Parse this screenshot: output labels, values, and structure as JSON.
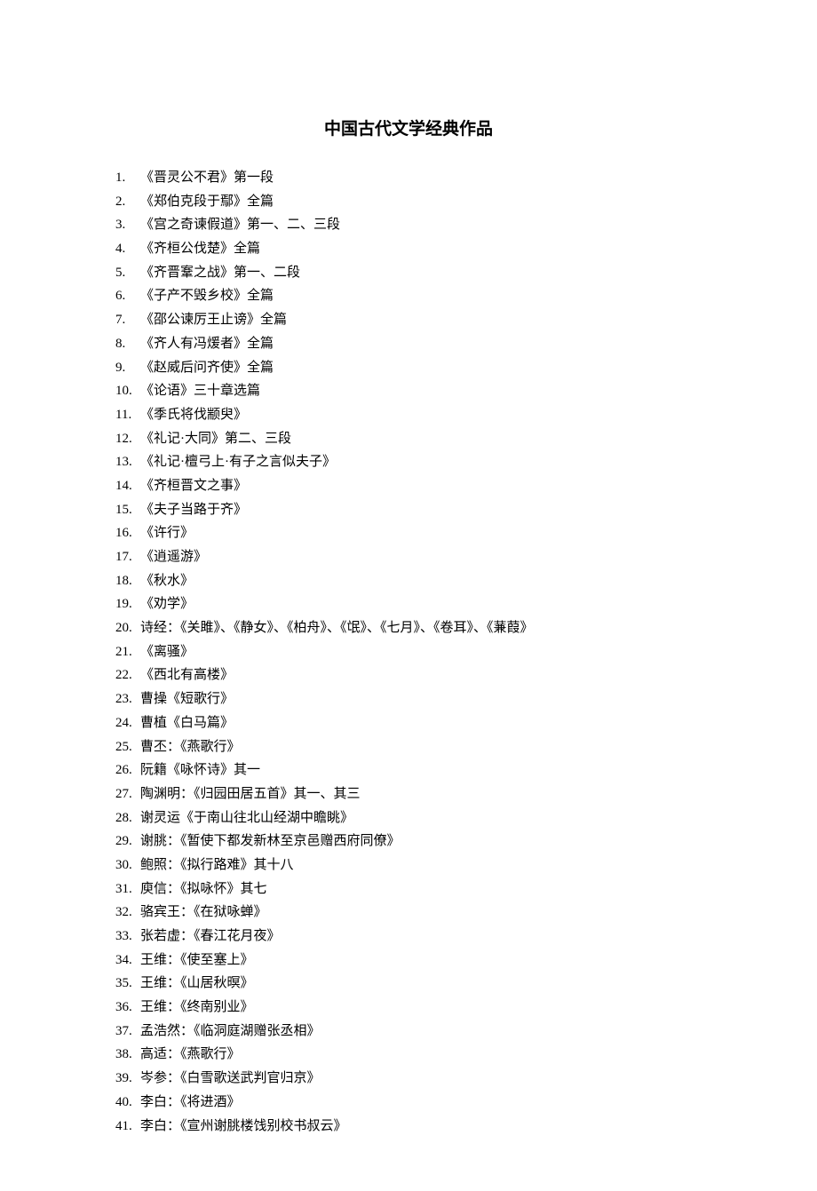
{
  "title": "中国古代文学经典作品",
  "items": [
    {
      "num": "1.",
      "text": "《晋灵公不君》第一段"
    },
    {
      "num": "2.",
      "text": "《郑伯克段于鄢》全篇"
    },
    {
      "num": "3.",
      "text": "《宫之奇谏假道》第一、二、三段"
    },
    {
      "num": "4.",
      "text": "《齐桓公伐楚》全篇"
    },
    {
      "num": "5.",
      "text": "《齐晋鞌之战》第一、二段"
    },
    {
      "num": "6.",
      "text": "《子产不毁乡校》全篇"
    },
    {
      "num": "7.",
      "text": "《邵公谏厉王止谤》全篇"
    },
    {
      "num": "8.",
      "text": "《齐人有冯煖者》全篇"
    },
    {
      "num": "9.",
      "text": "《赵威后问齐使》全篇"
    },
    {
      "num": "10.",
      "text": "《论语》三十章选篇"
    },
    {
      "num": "11.",
      "text": "《季氏将伐颛臾》"
    },
    {
      "num": "12.",
      "text": "《礼记·大同》第二、三段"
    },
    {
      "num": "13.",
      "text": "《礼记·檀弓上·有子之言似夫子》"
    },
    {
      "num": "14.",
      "text": "《齐桓晋文之事》"
    },
    {
      "num": "15.",
      "text": "《夫子当路于齐》"
    },
    {
      "num": "16.",
      "text": "《许行》"
    },
    {
      "num": "17.",
      "text": "《逍遥游》"
    },
    {
      "num": "18.",
      "text": "《秋水》"
    },
    {
      "num": "19.",
      "text": "《劝学》"
    },
    {
      "num": "20.",
      "text": "诗经：《关雎》、《静女》、《柏舟》、《氓》、《七月》、《卷耳》、《蒹葭》"
    },
    {
      "num": "21.",
      "text": "《离骚》"
    },
    {
      "num": "22.",
      "text": "《西北有高楼》"
    },
    {
      "num": "23.",
      "text": "曹操《短歌行》"
    },
    {
      "num": "24.",
      "text": "曹植《白马篇》"
    },
    {
      "num": "25.",
      "text": "曹丕：《燕歌行》"
    },
    {
      "num": "26.",
      "text": "阮籍《咏怀诗》其一"
    },
    {
      "num": "27.",
      "text": "陶渊明：《归园田居五首》其一、其三"
    },
    {
      "num": "28.",
      "text": "谢灵运《于南山往北山经湖中瞻眺》"
    },
    {
      "num": "29.",
      "text": "谢朓：《暂使下都发新林至京邑赠西府同僚》"
    },
    {
      "num": "30.",
      "text": "鲍照：《拟行路难》其十八"
    },
    {
      "num": "31.",
      "text": "庾信：《拟咏怀》其七"
    },
    {
      "num": "32.",
      "text": "骆宾王：《在狱咏蝉》"
    },
    {
      "num": "33.",
      "text": "张若虚：《春江花月夜》"
    },
    {
      "num": "34.",
      "text": "王维：《使至塞上》"
    },
    {
      "num": "35.",
      "text": "王维：《山居秋暝》"
    },
    {
      "num": "36.",
      "text": "王维：《终南别业》"
    },
    {
      "num": "37.",
      "text": "孟浩然：《临洞庭湖赠张丞相》"
    },
    {
      "num": "38.",
      "text": "高适：《燕歌行》"
    },
    {
      "num": "39.",
      "text": "岑参：《白雪歌送武判官归京》"
    },
    {
      "num": "40.",
      "text": "李白：《将进酒》"
    },
    {
      "num": "41.",
      "text": "李白：《宣州谢朓楼饯别校书叔云》"
    }
  ]
}
